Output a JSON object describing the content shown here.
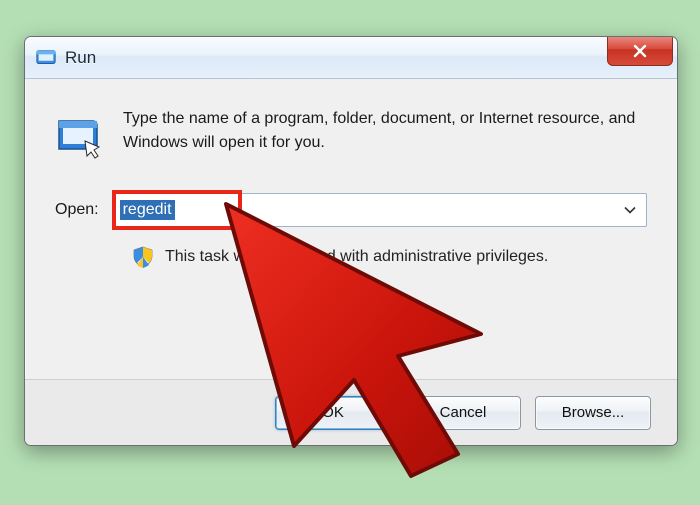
{
  "window": {
    "title": "Run"
  },
  "dialog": {
    "description": "Type the name of a program, folder, document, or Internet resource, and Windows will open it for you.",
    "open_label": "Open:",
    "input_value": "regedit",
    "privilege_note": "This task will be created with administrative privileges."
  },
  "buttons": {
    "ok": "OK",
    "cancel": "Cancel",
    "browse": "Browse..."
  }
}
